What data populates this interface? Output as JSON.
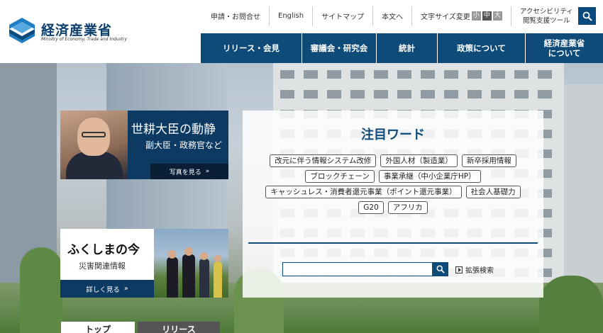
{
  "logo": {
    "name_ja": "経済産業省",
    "name_en": "Ministry of Economy, Trade and Industry"
  },
  "util_nav": {
    "contact": "申請・お問合せ",
    "english": "English",
    "sitemap": "サイトマップ",
    "skip": "本文へ",
    "font_size_label": "文字サイズ変更",
    "font_small": "小",
    "font_mid": "中",
    "font_large": "大",
    "accessibility_line1": "アクセシビリティ",
    "accessibility_line2": "閲覧支援ツール"
  },
  "global_nav": [
    {
      "label": "リリース・会見"
    },
    {
      "label": "審議会・研究会"
    },
    {
      "label": "統計"
    },
    {
      "label": "政策について"
    },
    {
      "label_line1": "経済産業省",
      "label_line2": "について"
    }
  ],
  "minister": {
    "title": "世耕大臣の動静",
    "subtitle": "副大臣・政務官など",
    "more": "写真を見る"
  },
  "fukushima": {
    "title": "ふくしまの今",
    "subtitle": "災害関連情報",
    "more": "詳しく見る"
  },
  "keywords": {
    "title": "注目ワード",
    "tags": [
      "改元に伴う情報システム改修",
      "外国人材（製造業）",
      "新卒採用情報",
      "ブロックチェーン",
      "事業承継（中小企業庁HP）",
      "キャッシュレス・消費者還元事業（ポイント還元事業）",
      "社会人基礎力",
      "G20",
      "アフリカ"
    ],
    "search_value": "",
    "advanced_search": "拡張検索"
  },
  "tabs": {
    "top": "トップ",
    "release": "リリース"
  },
  "colors": {
    "brand_navy": "#0e4b78",
    "dark_navy": "#0d3a63"
  }
}
